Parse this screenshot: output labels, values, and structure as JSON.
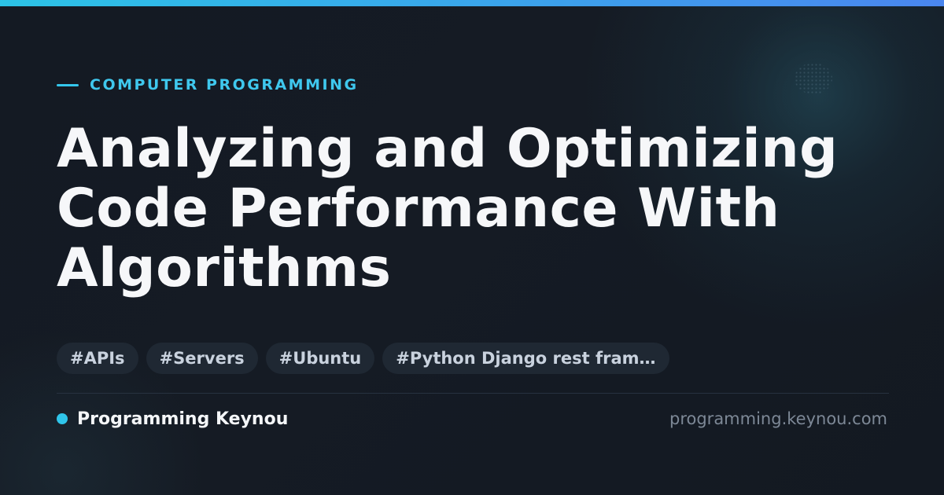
{
  "header": {
    "category": "COMPUTER PROGRAMMING",
    "title_lines": [
      "Analyzing and Optimizing",
      "Code Performance With",
      "Algorithms"
    ]
  },
  "tags": [
    "#APIs",
    "#Servers",
    "#Ubuntu",
    "#Python Django rest fram…"
  ],
  "footer": {
    "brand": "Programming Keynou",
    "domain": "programming.keynou.com"
  },
  "colors": {
    "accent": "#34c6ec",
    "background": "#141a23",
    "title": "#f6f7f9",
    "tag_background": "#1f2833",
    "tag_text": "#c9d2de",
    "domain_text": "#7d8896"
  }
}
